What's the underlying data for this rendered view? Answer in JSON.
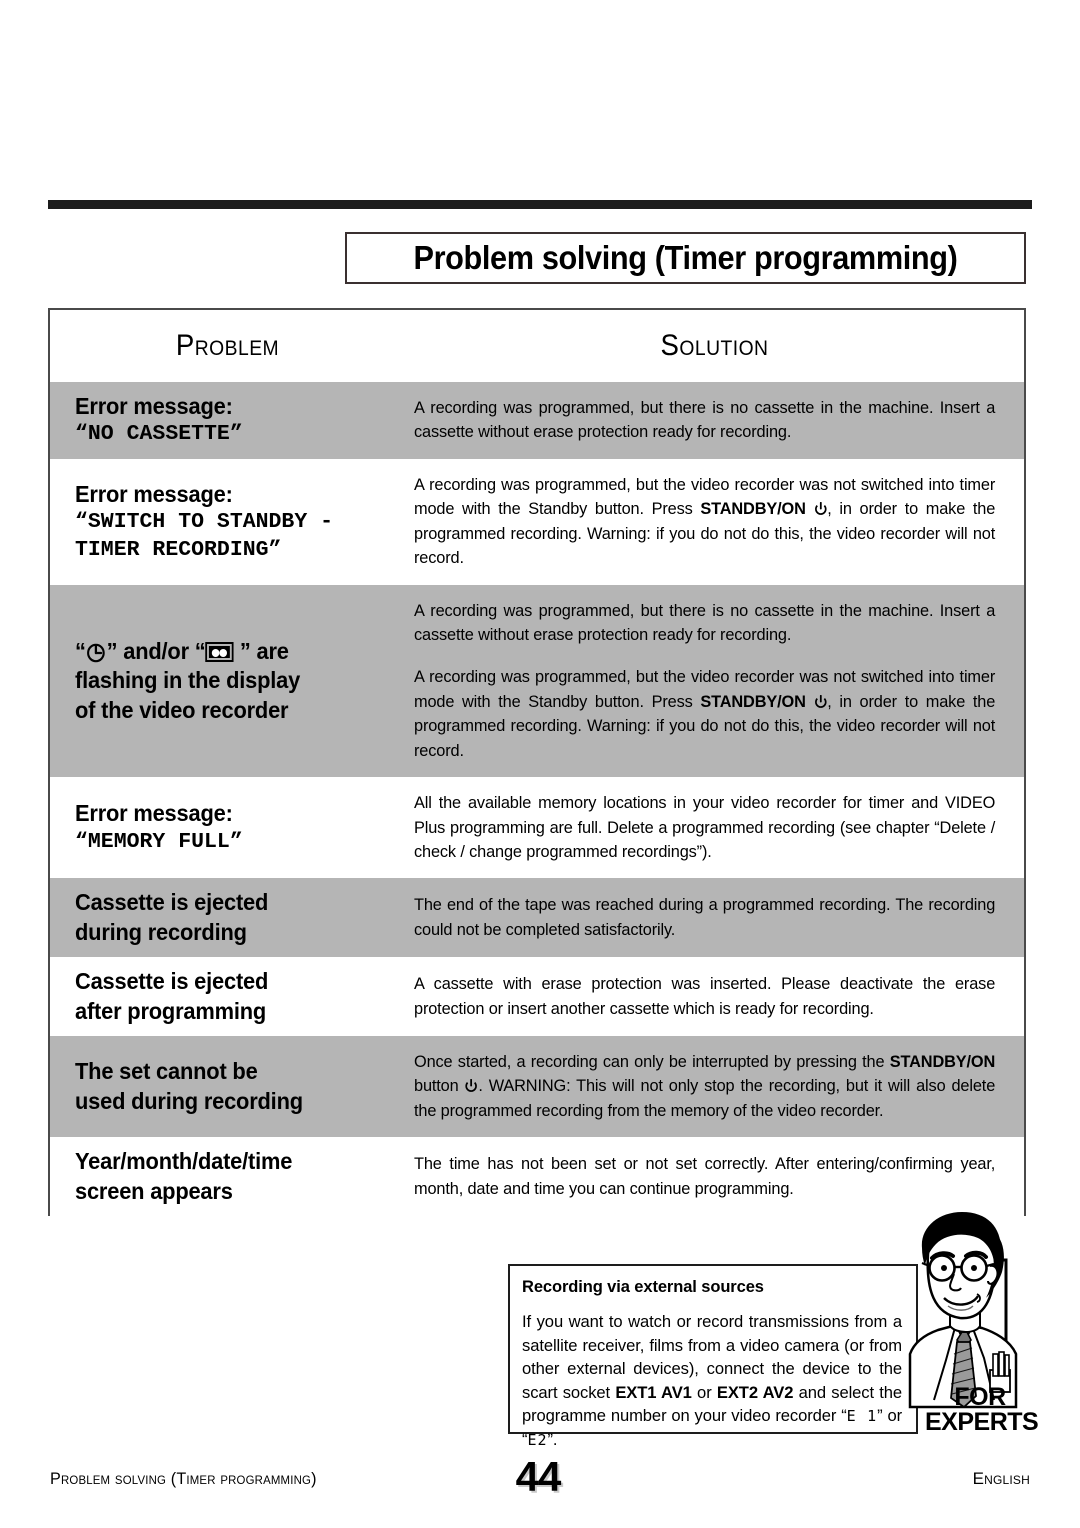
{
  "page": {
    "title": "Problem solving (Timer programming)"
  },
  "table": {
    "headers": {
      "problem": "Problem",
      "solution": "Solution"
    },
    "rows": [
      {
        "shaded": true,
        "problem_lines": [
          {
            "text": "Error message:",
            "style": "normal"
          },
          {
            "text": "“NO CASSETTE”",
            "style": "mono"
          }
        ],
        "solution_paragraphs": [
          "A recording was programmed, but there is no cassette in the machine. Insert a cassette without erase protection ready for recording."
        ]
      },
      {
        "shaded": false,
        "problem_lines": [
          {
            "text": "Error message:",
            "style": "normal"
          },
          {
            "text": "“SWITCH TO STANDBY -",
            "style": "mono"
          },
          {
            "text": "TIMER RECORDING”",
            "style": "mono"
          }
        ],
        "solution_paragraphs": [
          "A recording was programmed, but the video recorder was not switched into timer mode with the Standby button. Press STANDBY/ON ⏻, in order to make the programmed recording. Warning: if you do not do this, the video recorder will not record."
        ],
        "solution_bold": [
          "STANDBY/ON"
        ]
      },
      {
        "shaded": true,
        "problem_lines": [
          {
            "text": "“[clock]” and/or “[cassette] ” are",
            "style": "icons"
          },
          {
            "text": "flashing in the display",
            "style": "normal"
          },
          {
            "text": "of the video recorder",
            "style": "normal"
          }
        ],
        "solution_paragraphs": [
          "A recording was programmed, but there is no cassette in the machine. Insert a cassette without erase protection ready for recording.",
          "A recording was programmed, but the video recorder was not switched into timer mode with the Standby button. Press STANDBY/ON ⏻, in order to make the programmed recording. Warning: if you do not do this, the video recorder will not record."
        ],
        "solution_bold": [
          "STANDBY/ON"
        ]
      },
      {
        "shaded": false,
        "problem_lines": [
          {
            "text": "Error message:",
            "style": "normal"
          },
          {
            "text": "“MEMORY FULL”",
            "style": "mono"
          }
        ],
        "solution_paragraphs": [
          "All the available memory locations in your video recorder for timer and VIDEO Plus programming are full. Delete a programmed recording (see chapter “Delete / check / change programmed recordings”)."
        ]
      },
      {
        "shaded": true,
        "problem_lines": [
          {
            "text": "Cassette is ejected",
            "style": "normal"
          },
          {
            "text": "during recording",
            "style": "normal"
          }
        ],
        "solution_paragraphs": [
          "The end of the tape was reached during a programmed recording. The recording could not be completed satisfactorily."
        ]
      },
      {
        "shaded": false,
        "problem_lines": [
          {
            "text": "Cassette is ejected",
            "style": "normal"
          },
          {
            "text": "after programming",
            "style": "normal"
          }
        ],
        "solution_paragraphs": [
          "A cassette with erase protection was inserted. Please deactivate the erase protection or insert another cassette which is ready for recording."
        ]
      },
      {
        "shaded": true,
        "problem_lines": [
          {
            "text": "The set cannot be",
            "style": "normal"
          },
          {
            "text": "used during recording",
            "style": "normal"
          }
        ],
        "solution_paragraphs": [
          "Once started, a recording can only be interrupted by pressing the STANDBY/ON button ⏻.  WARNING: This will not only stop the recording, but it will also delete the programmed recording from the memory of the video recorder."
        ],
        "solution_bold": [
          "STANDBY/ON"
        ]
      },
      {
        "shaded": false,
        "problem_lines": [
          {
            "text": "Year/month/date/time",
            "style": "normal"
          },
          {
            "text": "screen appears",
            "style": "normal"
          }
        ],
        "solution_paragraphs": [
          "The time has not been set or not set correctly. After entering/confirming year, month, date and time you can continue programming."
        ]
      }
    ]
  },
  "expert_box": {
    "heading": "Recording via external sources",
    "body_part1": "If you want to watch or record transmissions from a satellite receiver, films from a video camera (or from other external devices), connect the device to the scart socket ",
    "scart1": "EXT1 AV1",
    "body_part2": " or ",
    "scart2": "EXT2 AV2",
    "body_part3": " and select the programme number on your video recorder “",
    "lcd1": "E 1",
    "body_part4": "” or “",
    "lcd2": "E2",
    "body_part5": "”.",
    "badge_line1": "FOR",
    "badge_line2": "EXPERTS"
  },
  "footer": {
    "left": "Problem solving (Timer programming)",
    "page": "44",
    "right": "English"
  },
  "colors": {
    "shaded_row": "#b5b5b5",
    "rule": "#1c1c1c",
    "border": "#4a4a4a"
  }
}
